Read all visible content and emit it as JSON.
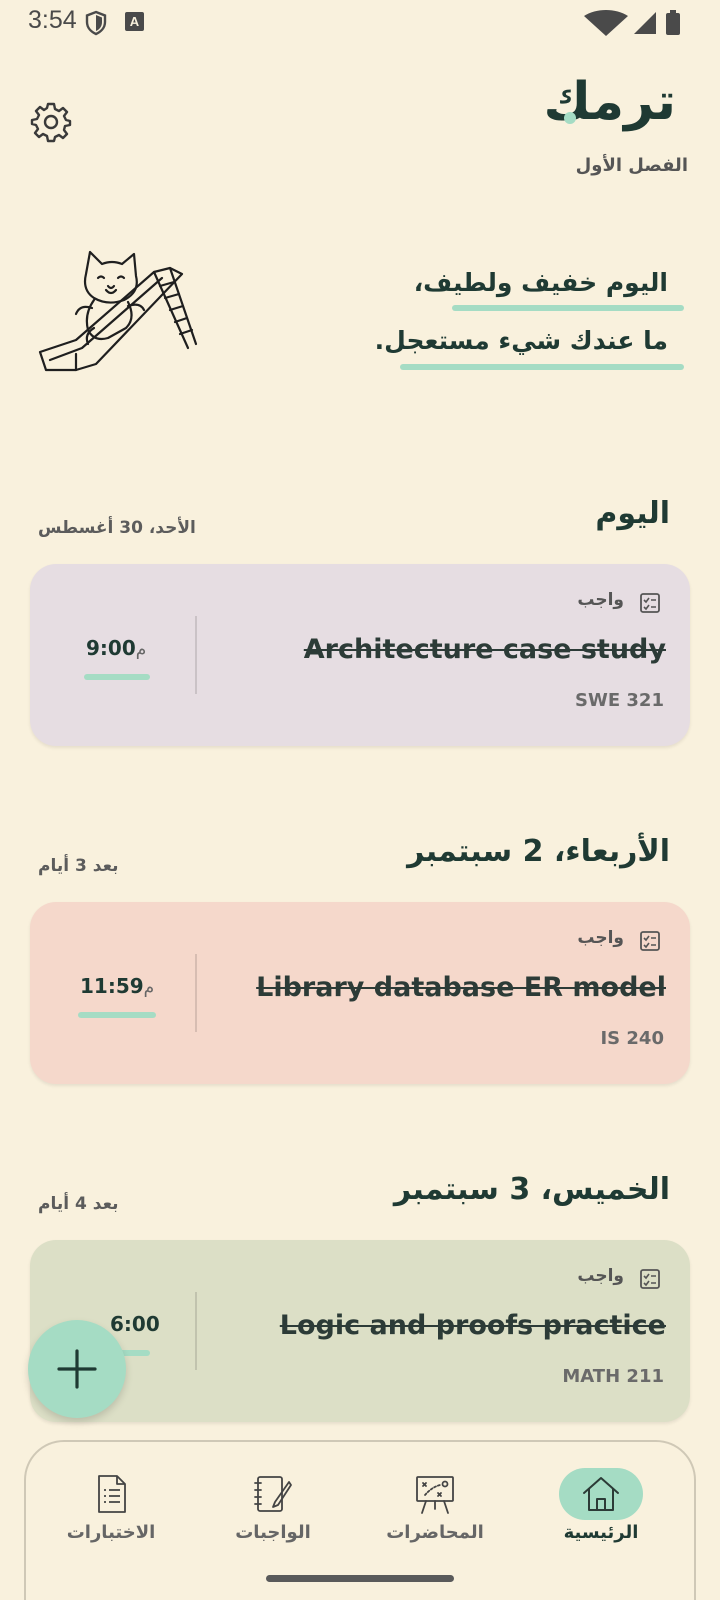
{
  "status": {
    "time": "3:54",
    "badge": "A"
  },
  "header": {
    "app_title": "ترمك",
    "semester": "الفصل الأول"
  },
  "hero": {
    "line1": "اليوم خفيف ولطيف،",
    "line2": "ما عندك شيء مستعجل."
  },
  "sections": [
    {
      "title": "اليوم",
      "subtitle": "الأحد، 30 أغسطس",
      "card": {
        "tag": "واجب",
        "title": "Architecture case study",
        "code": "SWE 321",
        "time": "9:00",
        "ampm": "م",
        "color": "#e6dde2"
      }
    },
    {
      "title": "الأربعاء، 2 سبتمبر",
      "subtitle": "بعد 3 أيام",
      "card": {
        "tag": "واجب",
        "title": "Library database ER model",
        "code": "IS 240",
        "time": "11:59",
        "ampm": "م",
        "color": "#f5d8cb"
      }
    },
    {
      "title": "الخميس، 3 سبتمبر",
      "subtitle": "بعد 4 أيام",
      "card": {
        "tag": "واجب",
        "title": "Logic and proofs practice",
        "code": "MATH 211",
        "time": "6:00",
        "ampm": "",
        "color": "#dcdfc6"
      }
    }
  ],
  "nav": {
    "items": [
      {
        "label": "الاختبارات",
        "icon": "document-list-icon"
      },
      {
        "label": "الواجبات",
        "icon": "notebook-pen-icon"
      },
      {
        "label": "المحاضرات",
        "icon": "presentation-board-icon"
      },
      {
        "label": "الرئيسية",
        "icon": "home-icon",
        "active": true
      }
    ]
  },
  "colors": {
    "accent": "#a5dcc4",
    "background": "#f9f1dd",
    "text": "#1f3a33"
  }
}
